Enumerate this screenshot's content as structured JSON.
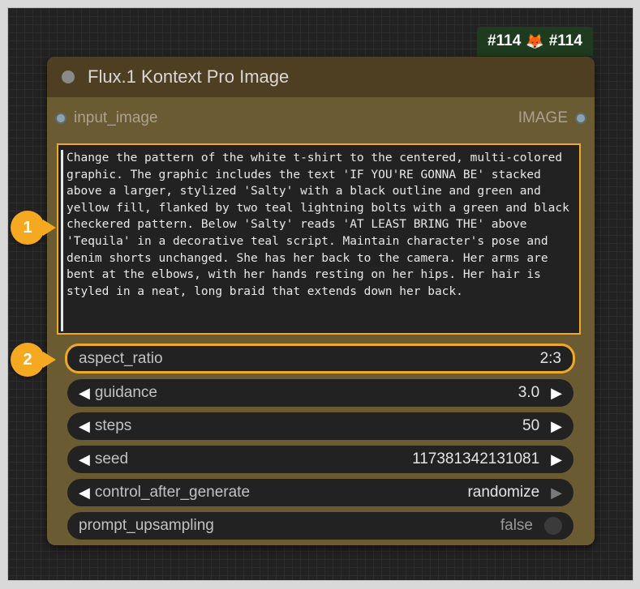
{
  "node_id": {
    "left": "#114",
    "right": "#114",
    "icon": "fox-icon"
  },
  "node": {
    "title": "Flux.1 Kontext Pro Image",
    "input_slot": "input_image",
    "output_slot": "IMAGE",
    "prompt": "Change the pattern of the white t-shirt to the centered, multi-colored graphic. The graphic includes the text 'IF YOU'RE GONNA BE' stacked above a larger, stylized 'Salty' with a black outline and green and yellow fill, flanked by two teal lightning bolts with a green and black checkered pattern. Below 'Salty' reads 'AT LEAST BRING THE' above 'Tequila' in a decorative teal script. Maintain character's pose and denim shorts unchanged. She has her back to the camera. Her arms are bent at the elbows, with her hands resting on her hips. Her hair is styled in a neat, long braid that extends down her back.",
    "widgets": {
      "aspect_ratio": {
        "label": "aspect_ratio",
        "value": "2:3"
      },
      "guidance": {
        "label": "guidance",
        "value": "3.0"
      },
      "steps": {
        "label": "steps",
        "value": "50"
      },
      "seed": {
        "label": "seed",
        "value": "117381342131081"
      },
      "control_after_generate": {
        "label": "control_after_generate",
        "value": "randomize"
      },
      "prompt_upsampling": {
        "label": "prompt_upsampling",
        "value": "false"
      }
    }
  },
  "callouts": {
    "one": "1",
    "two": "2"
  },
  "colors": {
    "accent": "#f0a829",
    "node_body": "#6b5b33",
    "node_header": "#4f3f22"
  },
  "arrows": {
    "left": "◀",
    "right": "▶"
  }
}
